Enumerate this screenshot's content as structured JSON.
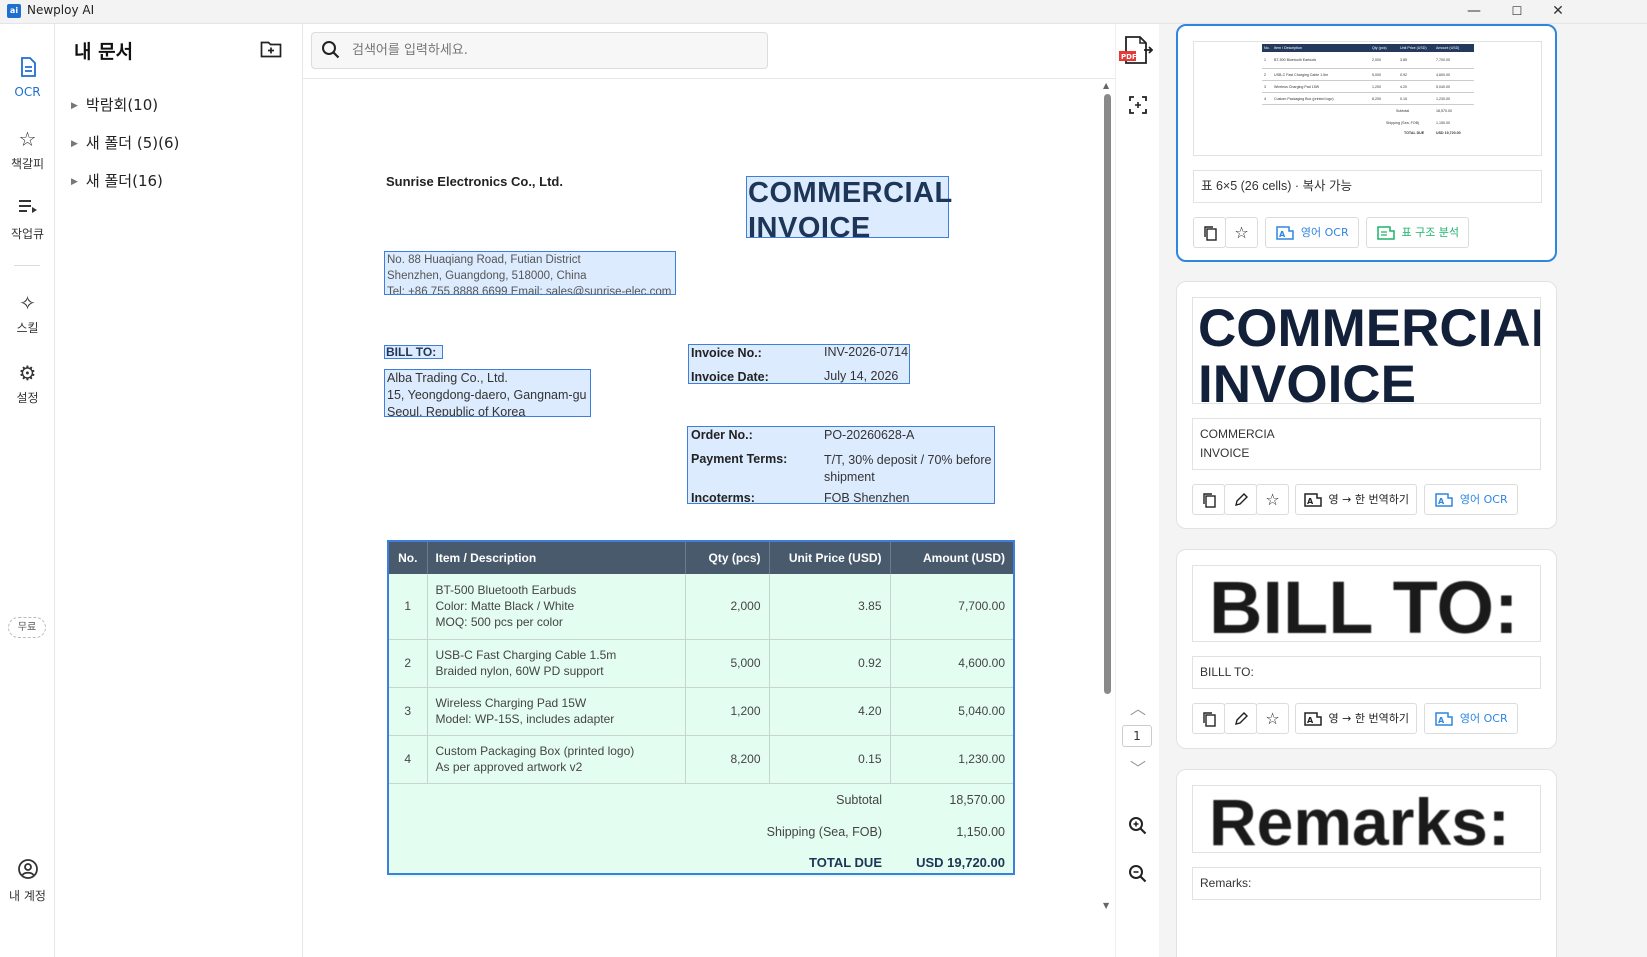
{
  "app": {
    "title": "Newploy AI",
    "min": "—",
    "max": "☐",
    "close": "✕"
  },
  "rail": {
    "ocr": "OCR",
    "bookmarks": "책갈피",
    "queue": "작업큐",
    "skills": "스킬",
    "settings": "설정",
    "free_badge": "무료",
    "account": "내 계정"
  },
  "docs": {
    "title": "내 문서",
    "folders": [
      {
        "label": "박람회(10)"
      },
      {
        "label": "새 폴더 (5)(6)"
      },
      {
        "label": "새 폴더(16)"
      }
    ]
  },
  "search": {
    "placeholder": "검색어를 입력하세요."
  },
  "viewer": {
    "page": "1"
  },
  "invoice": {
    "company": "Sunrise Electronics Co., Ltd.",
    "title_line1": "COMMERCIAL",
    "title_line2": "INVOICE",
    "address": [
      "No. 88 Huaqiang Road, Futian District",
      "Shenzhen, Guangdong, 518000, China",
      "Tel: +86 755 8888 6699   Email: sales@sunrise-elec.com"
    ],
    "bill_to_label": "BILL TO:",
    "bill_to": [
      "Alba Trading Co., Ltd.",
      "15, Yeongdong-daero, Gangnam-gu",
      "Seoul, Republic of Korea"
    ],
    "invoice_no_label": "Invoice No.:",
    "invoice_no": "INV-2026-0714",
    "invoice_date_label": "Invoice Date:",
    "invoice_date": "July 14, 2026",
    "order_no_label": "Order No.:",
    "order_no": "PO-20260628-A",
    "payment_terms_label": "Payment Terms:",
    "payment_terms": [
      "T/T, 30% deposit / 70% before",
      "shipment"
    ],
    "incoterms_label": "Incoterms:",
    "incoterms": "FOB Shenzhen",
    "columns": [
      "No.",
      "Item / Description",
      "Qty (pcs)",
      "Unit Price (USD)",
      "Amount (USD)"
    ],
    "rows": [
      {
        "no": "1",
        "desc": [
          "BT-500 Bluetooth Earbuds",
          "Color: Matte Black / White",
          "MOQ: 500 pcs per color"
        ],
        "qty": "2,000",
        "price": "3.85",
        "amount": "7,700.00"
      },
      {
        "no": "2",
        "desc": [
          "USB-C Fast Charging Cable 1.5m",
          "Braided nylon, 60W PD support"
        ],
        "qty": "5,000",
        "price": "0.92",
        "amount": "4,600.00"
      },
      {
        "no": "3",
        "desc": [
          "Wireless Charging Pad 15W",
          "Model: WP-15S, includes adapter"
        ],
        "qty": "1,200",
        "price": "4.20",
        "amount": "5,040.00"
      },
      {
        "no": "4",
        "desc": [
          "Custom Packaging Box (printed logo)",
          "As per approved artwork v2"
        ],
        "qty": "8,200",
        "price": "0.15",
        "amount": "1,230.00"
      }
    ],
    "subtotal_label": "Subtotal",
    "subtotal": "18,570.00",
    "shipping_label": "Shipping (Sea, FOB)",
    "shipping": "1,150.00",
    "total_label": "TOTAL DUE",
    "total": "USD 19,720.00"
  },
  "results": {
    "card1": {
      "mini_cols": [
        "No.",
        "Item / Description",
        "Qty (pcs)",
        "Unit Price (USD)",
        "Amount (USD)"
      ],
      "mini_rows": [
        [
          "1",
          "BT-500 Bluetooth Earbuds",
          "2,000",
          "3.85",
          "7,700.00"
        ],
        [
          "2",
          "USB-C Fast Charging Cable 1.5m",
          "5,000",
          "0.92",
          "4,600.00"
        ],
        [
          "3",
          "Wireless Charging Pad 15W",
          "1,200",
          "4.20",
          "5,040.00"
        ],
        [
          "4",
          "Custom Packaging Box (printed logo)",
          "8,200",
          "0.15",
          "1,230.00"
        ]
      ],
      "mini_subtotal_label": "Subtotal",
      "mini_subtotal": "18,570.00",
      "mini_shipping_label": "Shipping (Sea, FOB)",
      "mini_shipping": "1,150.00",
      "mini_total_label": "TOTAL DUE",
      "mini_total": "USD 19,720.00",
      "text": "표 6×5 (26 cells) · 복사 가능",
      "btn_en_ocr": "영어 OCR",
      "btn_table": "표 구조 분석"
    },
    "card2": {
      "snip_line1": "COMMERCIAL",
      "snip_line2": "INVOICE",
      "text_line1": "COMMERCIA",
      "text_line2": "INVOICE",
      "btn_translate": "영 → 한 번역하기",
      "btn_en_ocr": "영어 OCR"
    },
    "card3": {
      "snip": "BILL TO:",
      "text": "BILLL TO:",
      "btn_translate": "영 → 한 번역하기",
      "btn_en_ocr": "영어 OCR"
    },
    "card4": {
      "snip": "Remarks:",
      "text": "Remarks:"
    }
  },
  "colors": {
    "accent": "#2f86e0",
    "green": "#1db36b",
    "table_header": "#485a6b",
    "table_fill": "#e4fdf1",
    "highlight": "#3c7fdc"
  }
}
